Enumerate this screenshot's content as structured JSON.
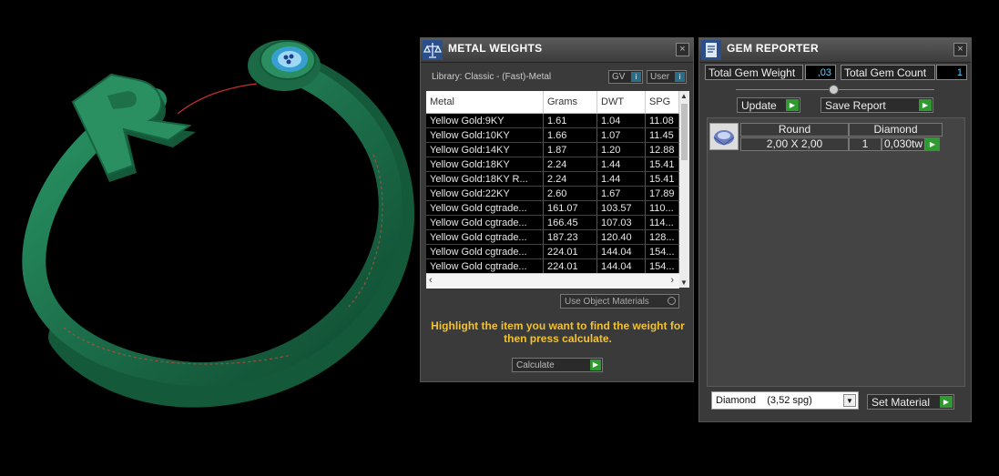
{
  "metal_panel": {
    "title": "METAL WEIGHTS",
    "close": "×",
    "library": "Library: Classic - (Fast)-Metal",
    "gv_label": "GV",
    "user_label": "User",
    "columns": [
      "Metal",
      "Grams",
      "DWT",
      "SPG"
    ],
    "rows": [
      [
        "Yellow Gold:9KY",
        "1.61",
        "1.04",
        "11.08"
      ],
      [
        "Yellow Gold:10KY",
        "1.66",
        "1.07",
        "11.45"
      ],
      [
        "Yellow Gold:14KY",
        "1.87",
        "1.20",
        "12.88"
      ],
      [
        "Yellow Gold:18KY",
        "2.24",
        "1.44",
        "15.41"
      ],
      [
        "Yellow Gold:18KY R...",
        "2.24",
        "1.44",
        "15.41"
      ],
      [
        "Yellow Gold:22KY",
        "2.60",
        "1.67",
        "17.89"
      ],
      [
        "Yellow Gold cgtrade...",
        "161.07",
        "103.57",
        "110..."
      ],
      [
        "Yellow Gold cgtrade...",
        "166.45",
        "107.03",
        "114..."
      ],
      [
        "Yellow Gold cgtrade...",
        "187.23",
        "120.40",
        "128..."
      ],
      [
        "Yellow Gold cgtrade...",
        "224.01",
        "144.04",
        "154..."
      ],
      [
        "Yellow Gold cgtrade...",
        "224.01",
        "144.04",
        "154..."
      ]
    ],
    "use_object_materials": "Use Object Materials",
    "hint": "Highlight the item you want to find the weight for then press calculate.",
    "calculate": "Calculate"
  },
  "gem_panel": {
    "title": "GEM REPORTER",
    "close": "×",
    "total_weight_label": "Total Gem Weight",
    "total_weight_value": ",03",
    "total_count_label": "Total Gem Count",
    "total_count_value": "1",
    "update": "Update",
    "save_report": "Save Report",
    "gem_header": [
      "Round",
      "Diamond"
    ],
    "gem_row": [
      "2,00 X 2,00",
      "1",
      "0,030tw"
    ],
    "material_select": "Diamond    (3,52 spg)",
    "set_material": "Set Material"
  },
  "ring": {
    "letter": "R",
    "color": "#1f7a52"
  },
  "colors": {
    "hint": "#f2c230",
    "accent_green": "#2f9a2f"
  }
}
